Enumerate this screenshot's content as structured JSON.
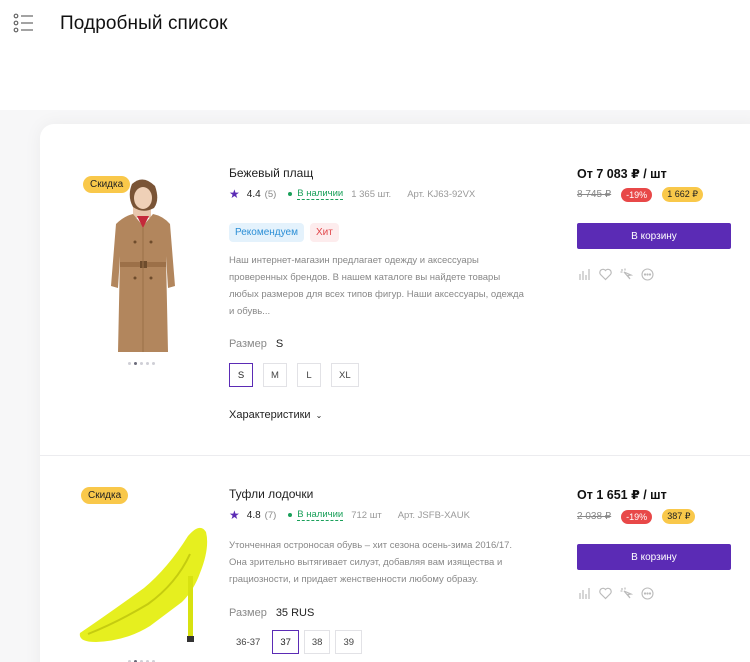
{
  "page": {
    "title": "Подробный список"
  },
  "products": [
    {
      "badge": "Скидка",
      "name": "Бежевый плащ",
      "rating": "4.4",
      "reviews": "(5)",
      "stock": "В наличии",
      "qty": "1 365 шт.",
      "sku": "Арт. KJ63-92VX",
      "tags": [
        "Рекомендуем",
        "Хит"
      ],
      "description": [
        "Наш интернет-магазин предлагает одежду и аксессуары",
        "проверенных брендов. В нашем каталоге вы найдете товары",
        "любых размеров для всех типов фигур. Наши аксессуары, одежда",
        "и обувь..."
      ],
      "size_label": "Размер",
      "size_value": "S",
      "sizes": [
        "S",
        "M",
        "L",
        "XL"
      ],
      "selected_size": "S",
      "characteristics": "Характеристики",
      "price": "От 7 083 ₽ / шт",
      "old_price": "8 745 ₽",
      "discount": "-19%",
      "savings": "1 662 ₽",
      "cart_button": "В корзину",
      "gallery": {
        "count": 5,
        "active": 1
      }
    },
    {
      "badge": "Скидка",
      "name": "Туфли лодочки",
      "rating": "4.8",
      "reviews": "(7)",
      "stock": "В наличии",
      "qty": "712 шт",
      "sku": "Арт. JSFB-XAUK",
      "description": [
        "Утонченная остроносая обувь – хит сезона осень-зима 2016/17.",
        "Она зрительно вытягивает силуэт, добавляя вам изящества и",
        "грациозности, и придает женственности любому образу."
      ],
      "size_label": "Размер",
      "size_value": "35 RUS",
      "sizes": [
        "36-37",
        "37",
        "38",
        "39"
      ],
      "selected_size": "37",
      "price": "От 1 651 ₽ / шт",
      "old_price": "2 038 ₽",
      "discount": "-19%",
      "savings": "387 ₽",
      "cart_button": "В корзину",
      "gallery": {
        "count": 5,
        "active": 1
      }
    }
  ],
  "colors": {
    "accent": "#5b2bb5",
    "sale_badge": "#f9c84a",
    "discount": "#e84848",
    "in_stock": "#1aa05a"
  },
  "icons": [
    "list-view-icon",
    "star-icon",
    "compare-icon",
    "favorite-icon",
    "quick-view-icon",
    "more-icon"
  ]
}
